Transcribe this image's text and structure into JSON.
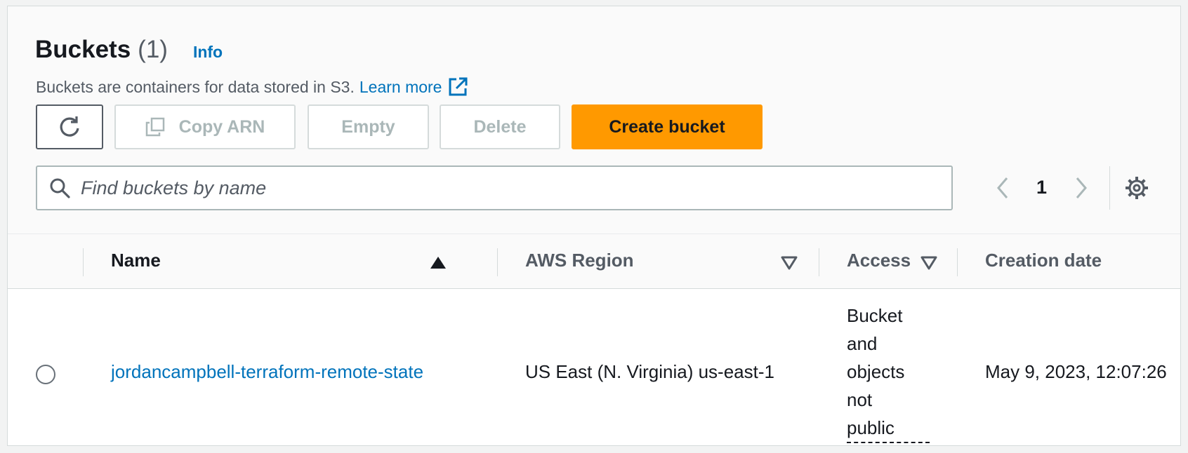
{
  "header": {
    "title": "Buckets",
    "count": "(1)",
    "info": "Info",
    "description": "Buckets are containers for data stored in S3.",
    "learn_more": "Learn more"
  },
  "toolbar": {
    "refresh_icon": "refresh-icon",
    "copy_arn": "Copy ARN",
    "empty": "Empty",
    "delete": "Delete",
    "create_bucket": "Create bucket"
  },
  "search": {
    "placeholder": "Find buckets by name"
  },
  "pagination": {
    "current_page": "1"
  },
  "table": {
    "columns": [
      "Name",
      "AWS Region",
      "Access",
      "Creation date"
    ],
    "rows": [
      {
        "name": "jordancampbell-terraform-remote-state",
        "region": "US East (N. Virginia) us-east-1",
        "access_lines": [
          "Bucket",
          "and",
          "objects",
          "not",
          "public"
        ],
        "creation_date": "May 9, 2023, 12:07:26"
      }
    ]
  },
  "colors": {
    "accent_link": "#0073bb",
    "primary_button": "#ff9900",
    "text": "#16191f",
    "muted_text": "#545b64",
    "disabled_text": "#aab7b8"
  }
}
